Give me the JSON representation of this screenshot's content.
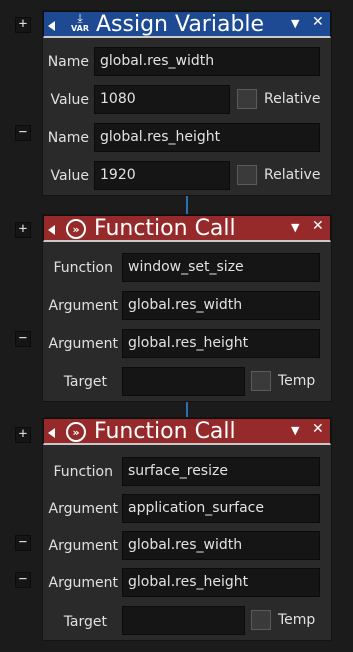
{
  "controls": {
    "expand": "+",
    "collapse": "−",
    "menu": "▼",
    "close": "✕"
  },
  "assign_block": {
    "title": "Assign Variable",
    "icon_label": "VAR",
    "rows": [
      {
        "label": "Name",
        "value": "global.res_width"
      },
      {
        "label": "Value",
        "value": "1080",
        "checkbox_label": "Relative"
      },
      {
        "label": "Name",
        "value": "global.res_height"
      },
      {
        "label": "Value",
        "value": "1920",
        "checkbox_label": "Relative"
      }
    ]
  },
  "function_call_1": {
    "title": "Function Call",
    "icon_label": "»",
    "function_label": "Function",
    "function_value": "window_set_size",
    "arguments": [
      {
        "label": "Argument",
        "value": "global.res_width"
      },
      {
        "label": "Argument",
        "value": "global.res_height"
      }
    ],
    "target_label": "Target",
    "target_value": "",
    "temp_label": "Temp"
  },
  "function_call_2": {
    "title": "Function Call",
    "icon_label": "»",
    "function_label": "Function",
    "function_value": "surface_resize",
    "arguments": [
      {
        "label": "Argument",
        "value": "application_surface"
      },
      {
        "label": "Argument",
        "value": "global.res_width"
      },
      {
        "label": "Argument",
        "value": "global.res_height"
      }
    ],
    "target_label": "Target",
    "target_value": "",
    "temp_label": "Temp"
  }
}
